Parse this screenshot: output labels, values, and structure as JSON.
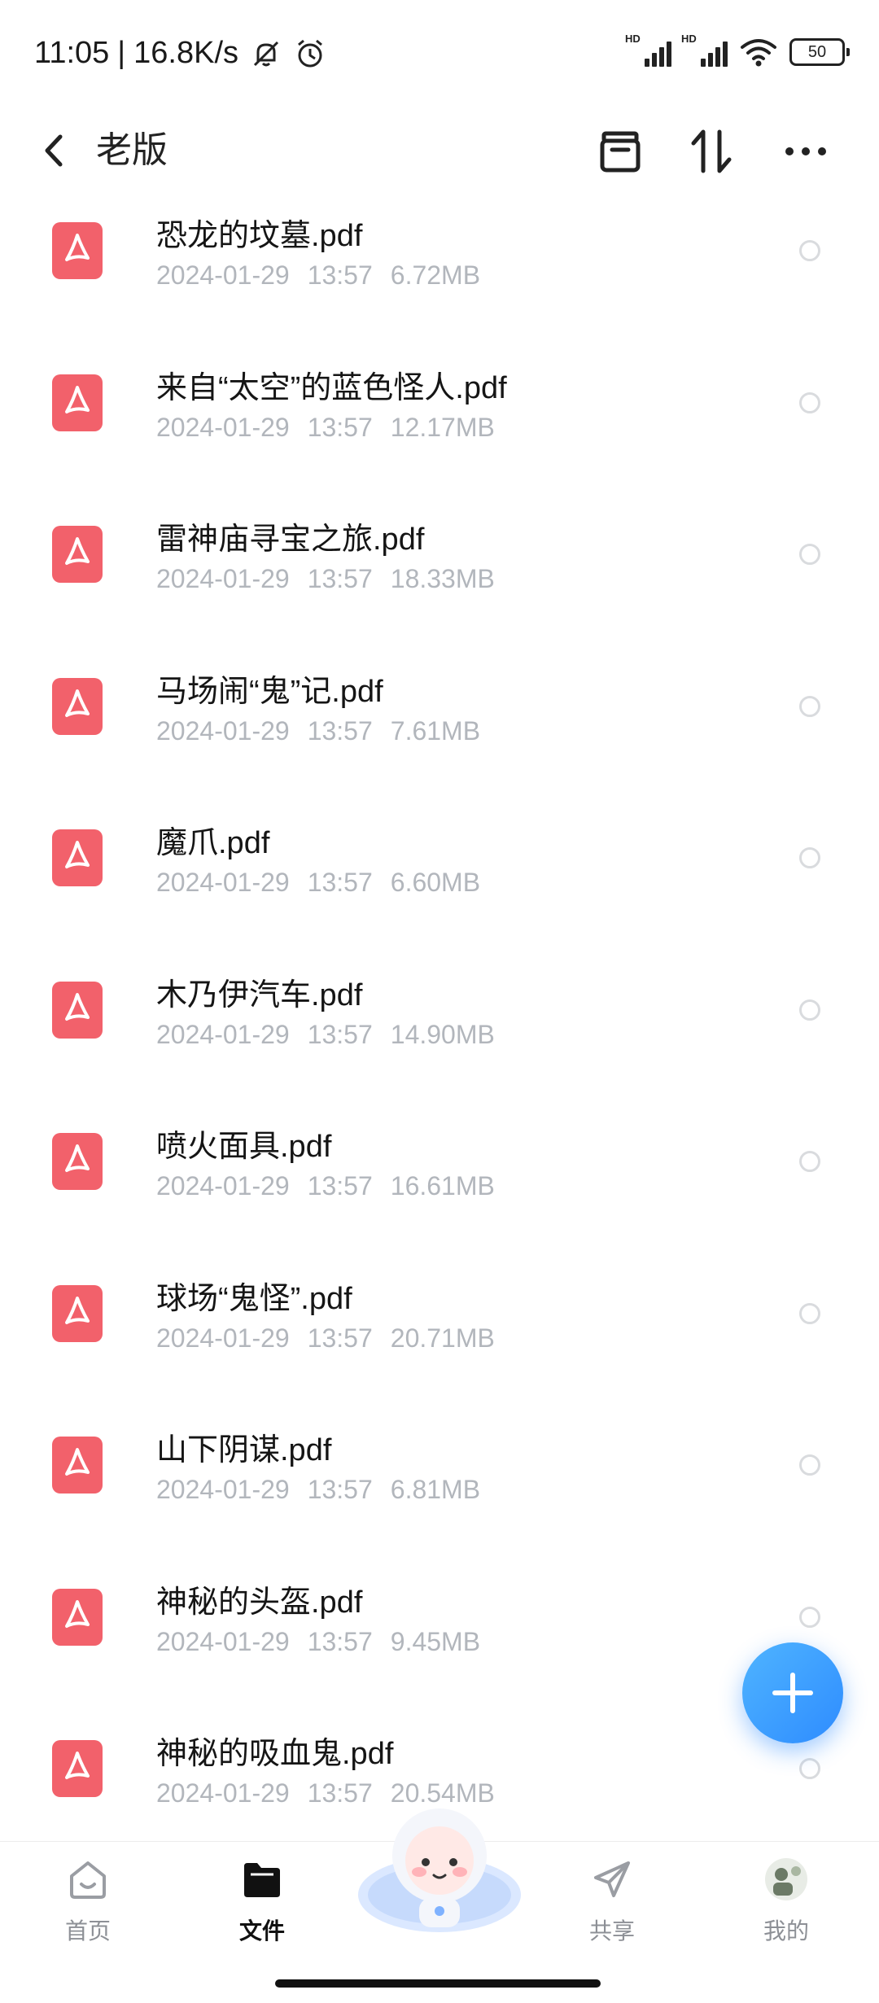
{
  "status_bar": {
    "time": "11:05",
    "separator": "|",
    "speed": "16.8K/s",
    "battery": "50",
    "icons": [
      "mute-bell-icon",
      "alarm-icon",
      "hd-signal-icon",
      "hd-signal-icon",
      "wifi-icon",
      "battery-icon"
    ]
  },
  "header": {
    "title": "老版",
    "icons": [
      "back-icon",
      "archive-icon",
      "sort-icon",
      "more-icon"
    ]
  },
  "files": [
    {
      "name": "恐龙的坟墓.pdf",
      "date": "2024-01-29",
      "time": "13:57",
      "size": "6.72MB"
    },
    {
      "name": "来自“太空”的蓝色怪人.pdf",
      "date": "2024-01-29",
      "time": "13:57",
      "size": "12.17MB"
    },
    {
      "name": "雷神庙寻宝之旅.pdf",
      "date": "2024-01-29",
      "time": "13:57",
      "size": "18.33MB"
    },
    {
      "name": "马场闹“鬼”记.pdf",
      "date": "2024-01-29",
      "time": "13:57",
      "size": "7.61MB"
    },
    {
      "name": "魔爪.pdf",
      "date": "2024-01-29",
      "time": "13:57",
      "size": "6.60MB"
    },
    {
      "name": "木乃伊汽车.pdf",
      "date": "2024-01-29",
      "time": "13:57",
      "size": "14.90MB"
    },
    {
      "name": "喷火面具.pdf",
      "date": "2024-01-29",
      "time": "13:57",
      "size": "16.61MB"
    },
    {
      "name": "球场“鬼怪”.pdf",
      "date": "2024-01-29",
      "time": "13:57",
      "size": "20.71MB"
    },
    {
      "name": "山下阴谋.pdf",
      "date": "2024-01-29",
      "time": "13:57",
      "size": "6.81MB"
    },
    {
      "name": "神秘的头盔.pdf",
      "date": "2024-01-29",
      "time": "13:57",
      "size": "9.45MB"
    },
    {
      "name": "神秘的吸血鬼.pdf",
      "date": "2024-01-29",
      "time": "13:57",
      "size": "20.54MB"
    }
  ],
  "fab": {
    "icon": "plus-icon"
  },
  "bottom_nav": {
    "home": "首页",
    "files": "文件",
    "share": "共享",
    "mine": "我的",
    "active": "files"
  },
  "colors": {
    "accent": "#2e8cff",
    "pdf_icon": "#f2616b",
    "meta_text": "#b2b6bc"
  }
}
